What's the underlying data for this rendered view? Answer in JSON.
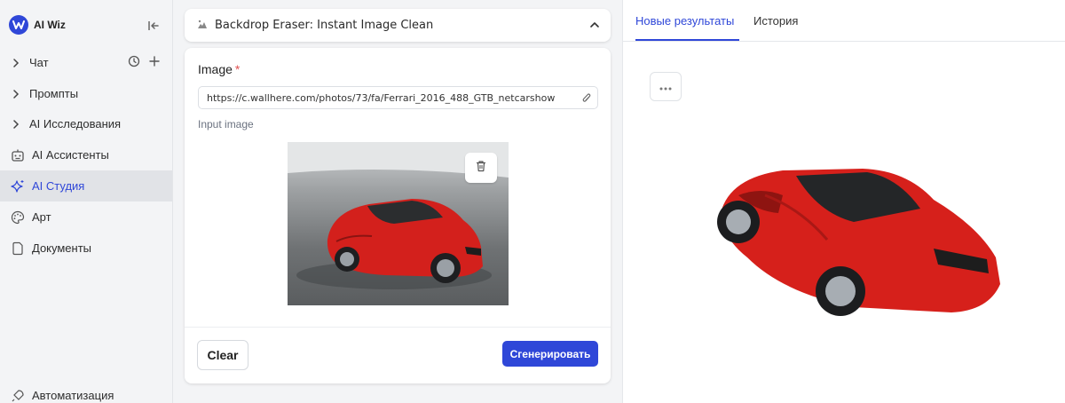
{
  "brand": {
    "name": "AI Wiz",
    "accent": "#2f47d8"
  },
  "sidebar": {
    "items": [
      {
        "label": "Чат",
        "expandable": true
      },
      {
        "label": "Промпты",
        "expandable": true
      },
      {
        "label": "AI Исследования",
        "expandable": true
      },
      {
        "label": "AI Ассистенты",
        "icon": "robot-icon"
      },
      {
        "label": "AI Студия",
        "icon": "sparkle-icon",
        "active": true
      },
      {
        "label": "Арт",
        "icon": "palette-icon"
      },
      {
        "label": "Документы",
        "icon": "document-icon"
      },
      {
        "label": "Автоматизация",
        "icon": "rocket-icon"
      }
    ]
  },
  "tool": {
    "title": "Backdrop Eraser: Instant Image Clean",
    "field_label": "Image",
    "required_mark": "*",
    "url_value": "https://c.wallhere.com/photos/73/fa/Ferrari_2016_488_GTB_netcarshow",
    "input_caption": "Input image",
    "clear_label": "Clear",
    "generate_label": "Сгенерировать"
  },
  "results": {
    "tabs": [
      {
        "label": "Новые результаты",
        "active": true
      },
      {
        "label": "История",
        "active": false
      }
    ]
  }
}
